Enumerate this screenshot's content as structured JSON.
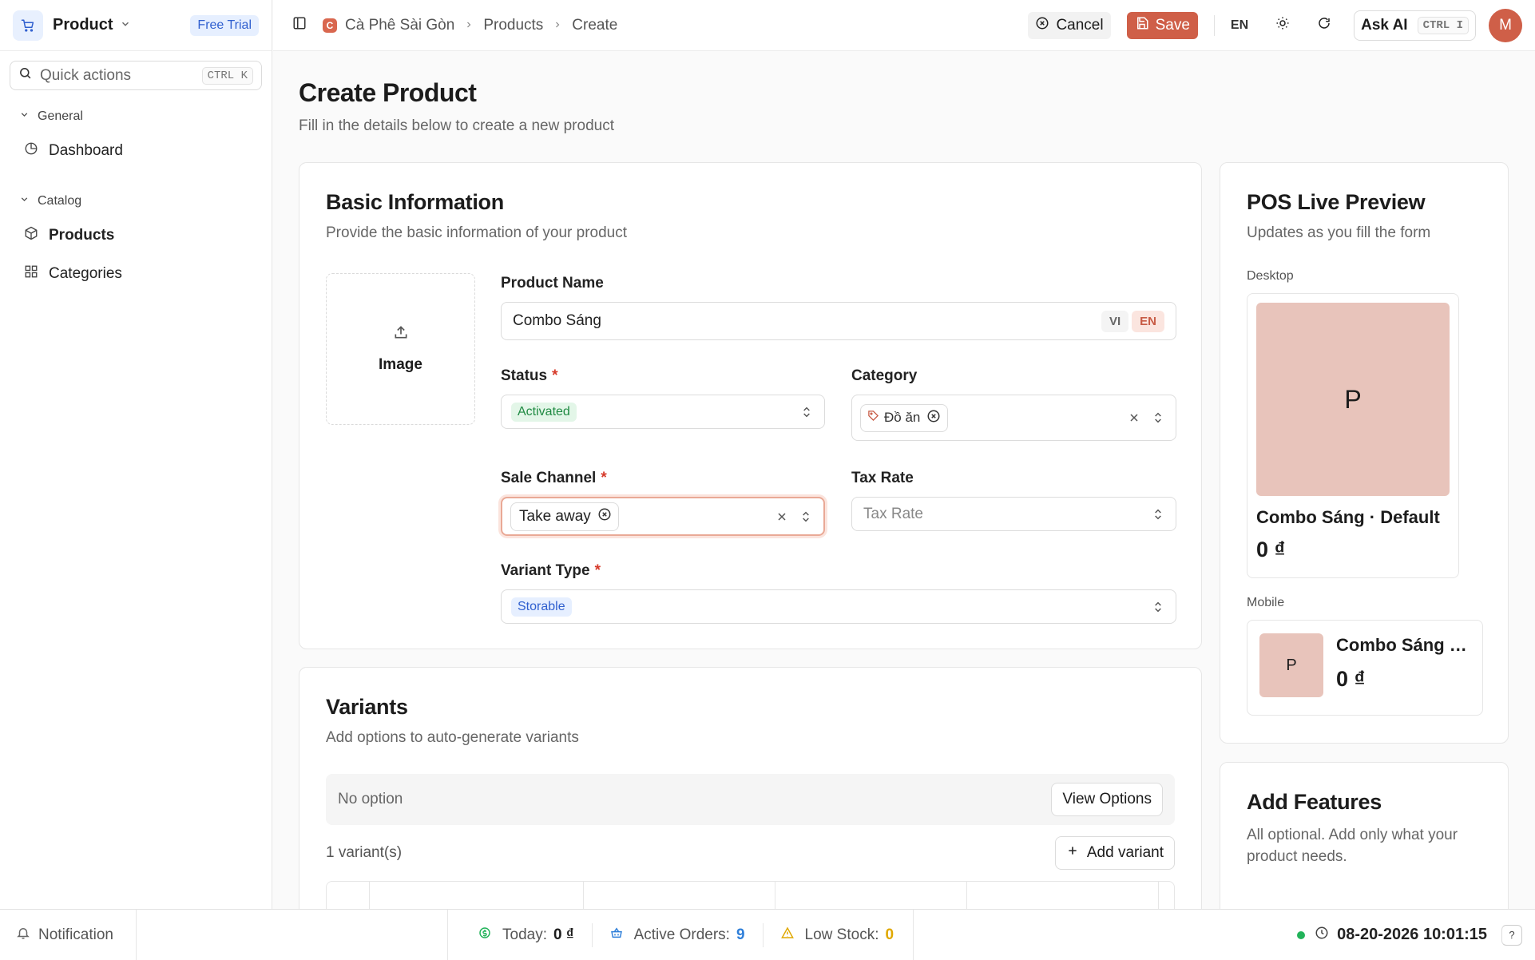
{
  "sidebar": {
    "app_name": "Product",
    "trial_badge": "Free Trial",
    "quick_actions": {
      "label": "Quick actions",
      "shortcut": "CTRL K"
    },
    "groups": [
      {
        "label": "General",
        "items": [
          {
            "label": "Dashboard",
            "icon": "pie-chart-icon"
          }
        ]
      },
      {
        "label": "Catalog",
        "items": [
          {
            "label": "Products",
            "icon": "box-icon"
          },
          {
            "label": "Categories",
            "icon": "grid-icon"
          }
        ]
      }
    ]
  },
  "topbar": {
    "breadcrumb": [
      "Cà Phê Sài Gòn",
      "Products",
      "Create"
    ],
    "brand_initial": "C",
    "cancel_label": "Cancel",
    "save_label": "Save",
    "language": "EN",
    "ask_ai": {
      "label": "Ask AI",
      "shortcut": "CTRL I"
    },
    "avatar_initial": "M"
  },
  "page": {
    "title": "Create Product",
    "subtitle": "Fill in the details below to create a new product"
  },
  "basic_info": {
    "title": "Basic Information",
    "subtitle": "Provide the basic information of your product",
    "image_label": "Image",
    "product_name": {
      "label": "Product Name",
      "value": "Combo Sáng",
      "lang_options": [
        "VI",
        "EN"
      ],
      "active_lang": "EN"
    },
    "status": {
      "label": "Status",
      "value": "Activated",
      "required_mark": "*"
    },
    "category": {
      "label": "Category",
      "chip": "Đồ ăn"
    },
    "sale_channel": {
      "label": "Sale Channel",
      "chip": "Take away",
      "required_mark": "*"
    },
    "tax_rate": {
      "label": "Tax Rate",
      "placeholder": "Tax Rate"
    },
    "variant_type": {
      "label": "Variant Type",
      "value": "Storable",
      "required_mark": "*"
    }
  },
  "variants": {
    "title": "Variants",
    "subtitle": "Add options to auto-generate variants",
    "no_option": "No option",
    "view_options": "View Options",
    "count": "1 variant(s)",
    "add_variant": "Add variant"
  },
  "preview": {
    "title": "POS Live Preview",
    "subtitle": "Updates as you fill the form",
    "desktop_label": "Desktop",
    "mobile_label": "Mobile",
    "placeholder_initial": "P",
    "item_name": "Combo Sáng · Default",
    "item_name_mobile": "Combo Sáng · Default",
    "price": "0 ₫"
  },
  "features": {
    "title": "Add Features",
    "subtitle": "All optional. Add only what your product needs."
  },
  "statusbar": {
    "notification": "Notification",
    "today": {
      "label": "Today:",
      "value": "0 ₫"
    },
    "active_orders": {
      "label": "Active Orders:",
      "value": "9"
    },
    "low_stock": {
      "label": "Low Stock:",
      "value": "0"
    },
    "datetime": "08-20-2026 10:01:15",
    "help": "?"
  },
  "colors": {
    "accent": "#cf5f48",
    "status_green": "#22b35a",
    "orders_blue": "#2f7fd9",
    "stock_amber": "#e0a800"
  }
}
